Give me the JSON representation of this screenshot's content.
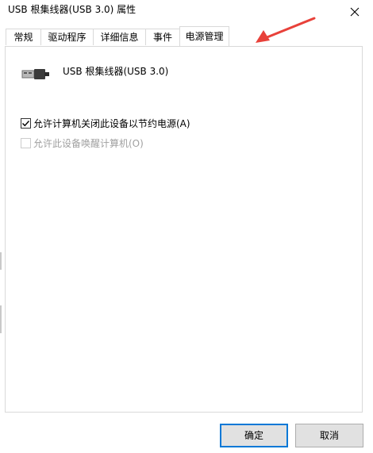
{
  "window": {
    "title": "USB 根集线器(USB 3.0) 属性"
  },
  "tabs": [
    {
      "label": "常规",
      "active": false
    },
    {
      "label": "驱动程序",
      "active": false
    },
    {
      "label": "详细信息",
      "active": false
    },
    {
      "label": "事件",
      "active": false
    },
    {
      "label": "电源管理",
      "active": true
    }
  ],
  "device": {
    "name": "USB 根集线器(USB 3.0)",
    "icon": "usb-connector-icon"
  },
  "options": {
    "allow_power_off": {
      "label": "允许计算机关闭此设备以节约电源(A)",
      "checked": true,
      "enabled": true
    },
    "allow_wake": {
      "label": "允许此设备唤醒计算机(O)",
      "checked": false,
      "enabled": false
    }
  },
  "buttons": {
    "ok": "确定",
    "cancel": "取消"
  },
  "colors": {
    "accent": "#0078d7",
    "annotation_arrow": "#e8413a",
    "button_face": "#e1e1e1"
  }
}
